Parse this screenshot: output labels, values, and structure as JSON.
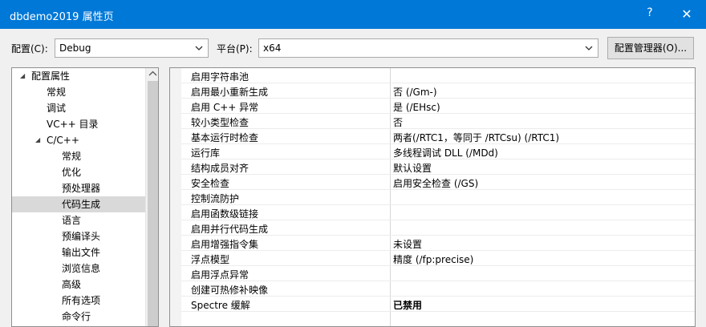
{
  "window": {
    "title": "dbdemo2019 属性页",
    "help_label": "?",
    "close_label": "✕"
  },
  "config": {
    "label": "配置(C):",
    "value": "Debug"
  },
  "platform": {
    "label": "平台(P):",
    "value": "x64"
  },
  "config_manager_label": "配置管理器(O)...",
  "tree": {
    "items": [
      {
        "label": "配置属性",
        "toggle": "◢"
      },
      {
        "label": "常规"
      },
      {
        "label": "调试"
      },
      {
        "label": "VC++ 目录"
      },
      {
        "label": "C/C++",
        "toggle": "◢"
      },
      {
        "label": "常规"
      },
      {
        "label": "优化"
      },
      {
        "label": "预处理器"
      },
      {
        "label": "代码生成"
      },
      {
        "label": "语言"
      },
      {
        "label": "预编译头"
      },
      {
        "label": "输出文件"
      },
      {
        "label": "浏览信息"
      },
      {
        "label": "高级"
      },
      {
        "label": "所有选项"
      },
      {
        "label": "命令行"
      }
    ]
  },
  "properties": [
    {
      "key": "启用字符串池",
      "value": ""
    },
    {
      "key": "启用最小重新生成",
      "value": "否 (/Gm-)"
    },
    {
      "key": "启用 C++ 异常",
      "value": "是 (/EHsc)"
    },
    {
      "key": "较小类型检查",
      "value": "否"
    },
    {
      "key": "基本运行时检查",
      "value": "两者(/RTC1，等同于 /RTCsu) (/RTC1)"
    },
    {
      "key": "运行库",
      "value": "多线程调试 DLL (/MDd)"
    },
    {
      "key": "结构成员对齐",
      "value": "默认设置"
    },
    {
      "key": "安全检查",
      "value": "启用安全检查 (/GS)"
    },
    {
      "key": "控制流防护",
      "value": ""
    },
    {
      "key": "启用函数级链接",
      "value": ""
    },
    {
      "key": "启用并行代码生成",
      "value": ""
    },
    {
      "key": "启用增强指令集",
      "value": "未设置"
    },
    {
      "key": "浮点模型",
      "value": "精度 (/fp:precise)"
    },
    {
      "key": "启用浮点异常",
      "value": ""
    },
    {
      "key": "创建可热修补映像",
      "value": ""
    },
    {
      "key": "Spectre 缓解",
      "value": "已禁用"
    }
  ]
}
